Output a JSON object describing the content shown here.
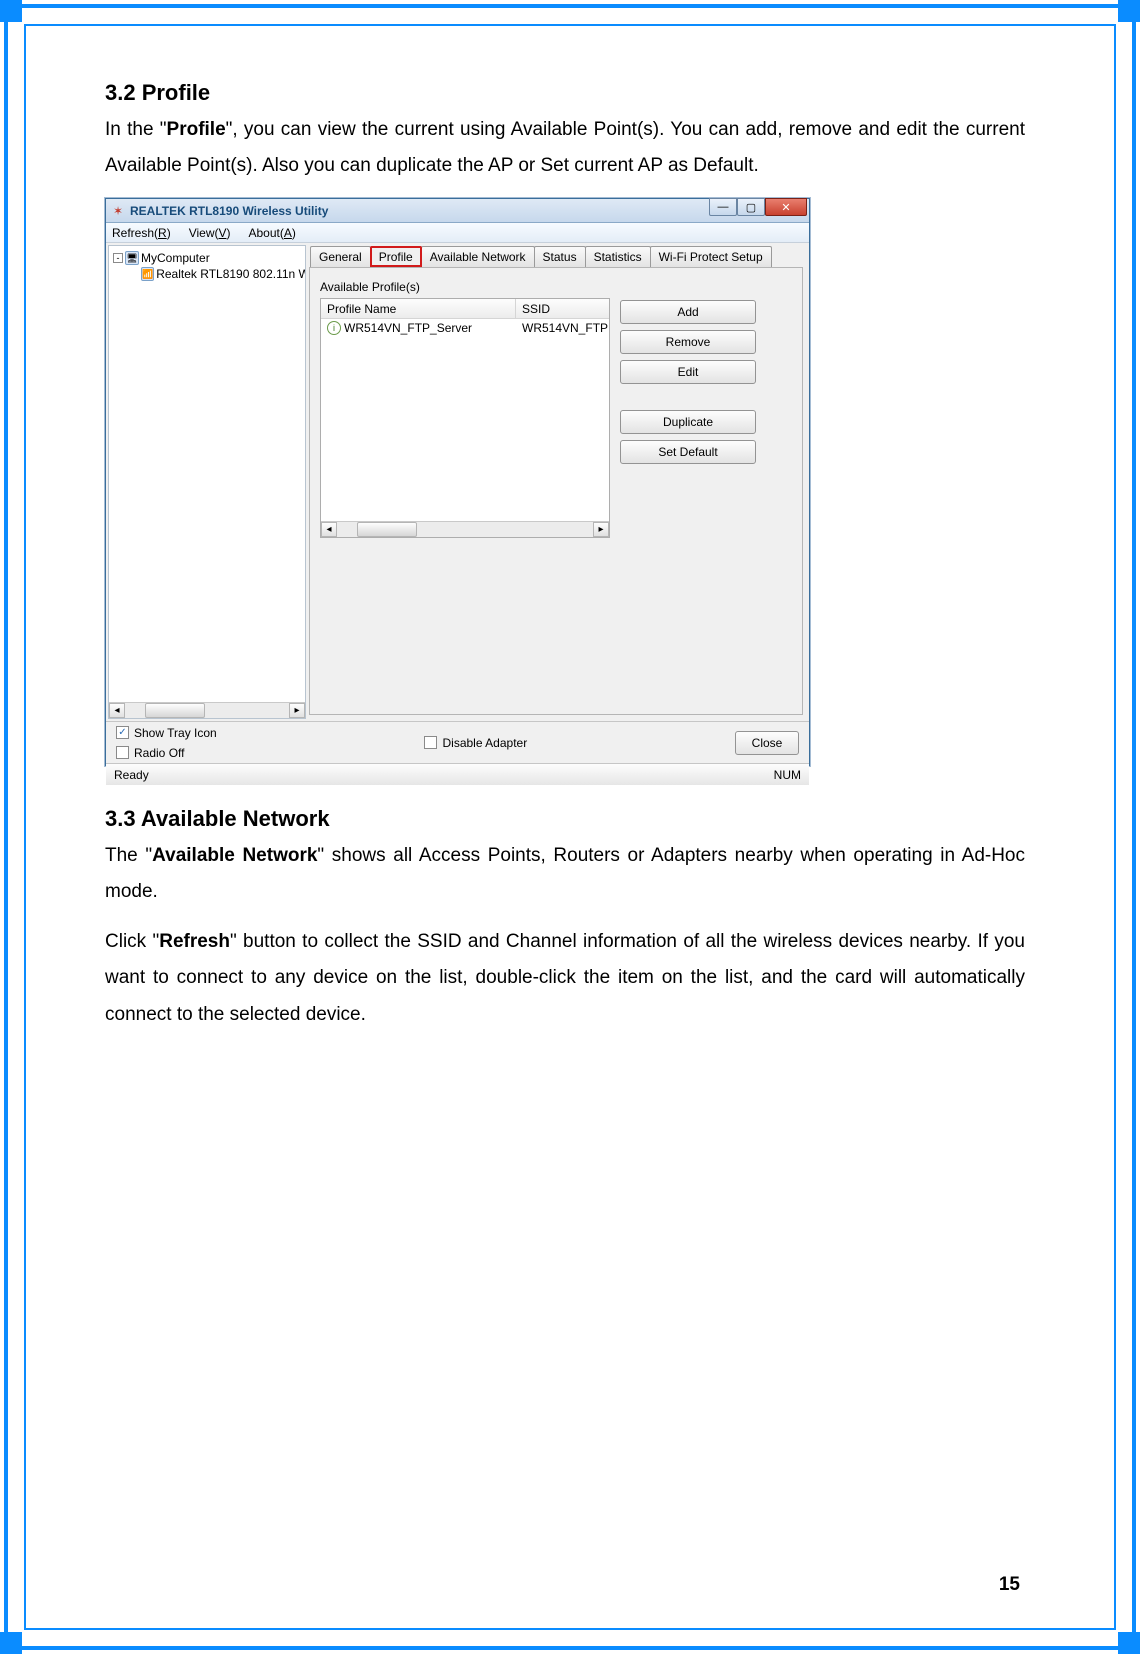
{
  "doc": {
    "section1": {
      "heading": "3.2 Profile",
      "para_pre": "In the \"",
      "para_bold": "Profile",
      "para_post": "\", you can view the current using Available Point(s). You can add, remove and edit the current Available Point(s). Also you can duplicate the AP or Set current AP as Default."
    },
    "section2": {
      "heading": "3.3  Available Network",
      "p1_pre": "The \"",
      "p1_bold": "Available Network",
      "p1_post": "\" shows all Access Points, Routers or Adapters nearby when operating in Ad-Hoc mode.",
      "p2_pre": "Click \"",
      "p2_bold": "Refresh",
      "p2_post": "\" button to collect the SSID and Channel information of all the wireless devices nearby. If you want to connect to any device on the list, double-click the item on the list, and the card will automatically connect to the selected device."
    },
    "page_number": "15"
  },
  "app": {
    "title": "REALTEK RTL8190 Wireless Utility",
    "menubar": {
      "refresh": {
        "pre": "Refresh(",
        "u": "R",
        "post": ")"
      },
      "view": {
        "pre": "View(",
        "u": "V",
        "post": ")"
      },
      "about": {
        "pre": "About(",
        "u": "A",
        "post": ")"
      }
    },
    "tree": {
      "root": "MyComputer",
      "child": "Realtek RTL8190 802.11n W"
    },
    "tabs": {
      "general": "General",
      "profile": "Profile",
      "available_network": "Available Network",
      "status": "Status",
      "statistics": "Statistics",
      "wps": "Wi-Fi Protect Setup"
    },
    "profile_panel": {
      "label": "Available Profile(s)",
      "columns": {
        "name": "Profile Name",
        "ssid": "SSID"
      },
      "row": {
        "name": "WR514VN_FTP_Server",
        "ssid": "WR514VN_FTP"
      },
      "buttons": {
        "add": "Add",
        "remove": "Remove",
        "edit": "Edit",
        "duplicate": "Duplicate",
        "set_default": "Set Default"
      }
    },
    "bottom": {
      "show_tray": "Show Tray Icon",
      "radio_off": "Radio Off",
      "disable_adapter": "Disable Adapter",
      "close": "Close"
    },
    "status": {
      "left": "Ready",
      "right": "NUM"
    }
  }
}
